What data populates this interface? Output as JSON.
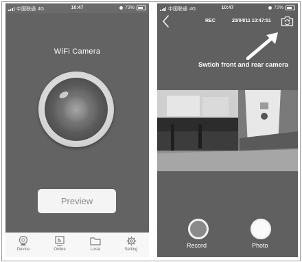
{
  "left_screen": {
    "status_bar": {
      "carrier": "中国联通",
      "network": "4G",
      "time": "10:47",
      "battery": "73%"
    },
    "app_title": "WiFi Camera",
    "preview_label": "Preview",
    "tabs": [
      {
        "label": "Device",
        "icon": "webcam-icon"
      },
      {
        "label": "Online",
        "icon": "online-icon"
      },
      {
        "label": "Local",
        "icon": "folder-icon"
      },
      {
        "label": "Setting",
        "icon": "gear-icon"
      }
    ]
  },
  "right_screen": {
    "status_bar": {
      "carrier": "中国联通",
      "network": "4G",
      "time": "10:47",
      "battery": "72%"
    },
    "rec_label": "REC",
    "datetime": "20/04/11 10:47:51",
    "annotation": "Swtich front and rear camera",
    "record_label": "Record",
    "photo_label": "Photo"
  }
}
